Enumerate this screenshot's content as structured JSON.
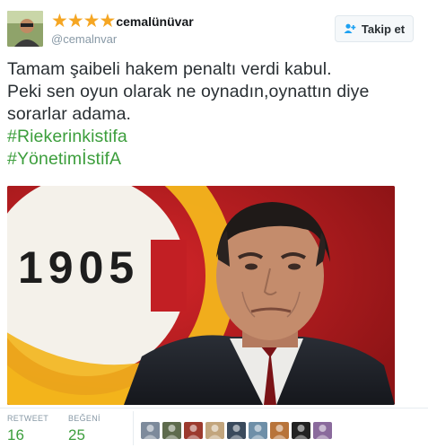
{
  "author": {
    "stars": "★★★★",
    "display_name": "cemalünüvar",
    "handle": "@cemalnvar"
  },
  "follow_button": {
    "label": "Takip et"
  },
  "tweet": {
    "lines": [
      "Tamam şaibeli hakem penaltı verdi kabul.",
      "Peki sen oyun olarak ne oynadın,oynattın diye",
      "sorarlar adama."
    ],
    "hashtags": [
      "#Riekerinkistifa",
      "#YönetimİstifA"
    ]
  },
  "media": {
    "logo_text": "1905"
  },
  "stats": {
    "retweet_label": "RETWEET",
    "retweet_count": "16",
    "like_label": "BEĞENİ",
    "like_count": "25"
  },
  "colors": {
    "accent": "#3c9e3c",
    "star": "#f5a623",
    "gs_red": "#b51d1d",
    "gs_yellow": "#f3b51c"
  },
  "likers": [
    {
      "name": "liker-avatar-1",
      "color": "#7d8a9b"
    },
    {
      "name": "liker-avatar-2",
      "color": "#5e6b4d"
    },
    {
      "name": "liker-avatar-3",
      "color": "#9c3a2e"
    },
    {
      "name": "liker-avatar-4",
      "color": "#c2a57d"
    },
    {
      "name": "liker-avatar-5",
      "color": "#3a4a5c"
    },
    {
      "name": "liker-avatar-6",
      "color": "#6e8fa8"
    },
    {
      "name": "liker-avatar-7",
      "color": "#b8743a"
    },
    {
      "name": "liker-avatar-8",
      "color": "#222222"
    },
    {
      "name": "liker-avatar-9",
      "color": "#8a6a9c"
    }
  ]
}
